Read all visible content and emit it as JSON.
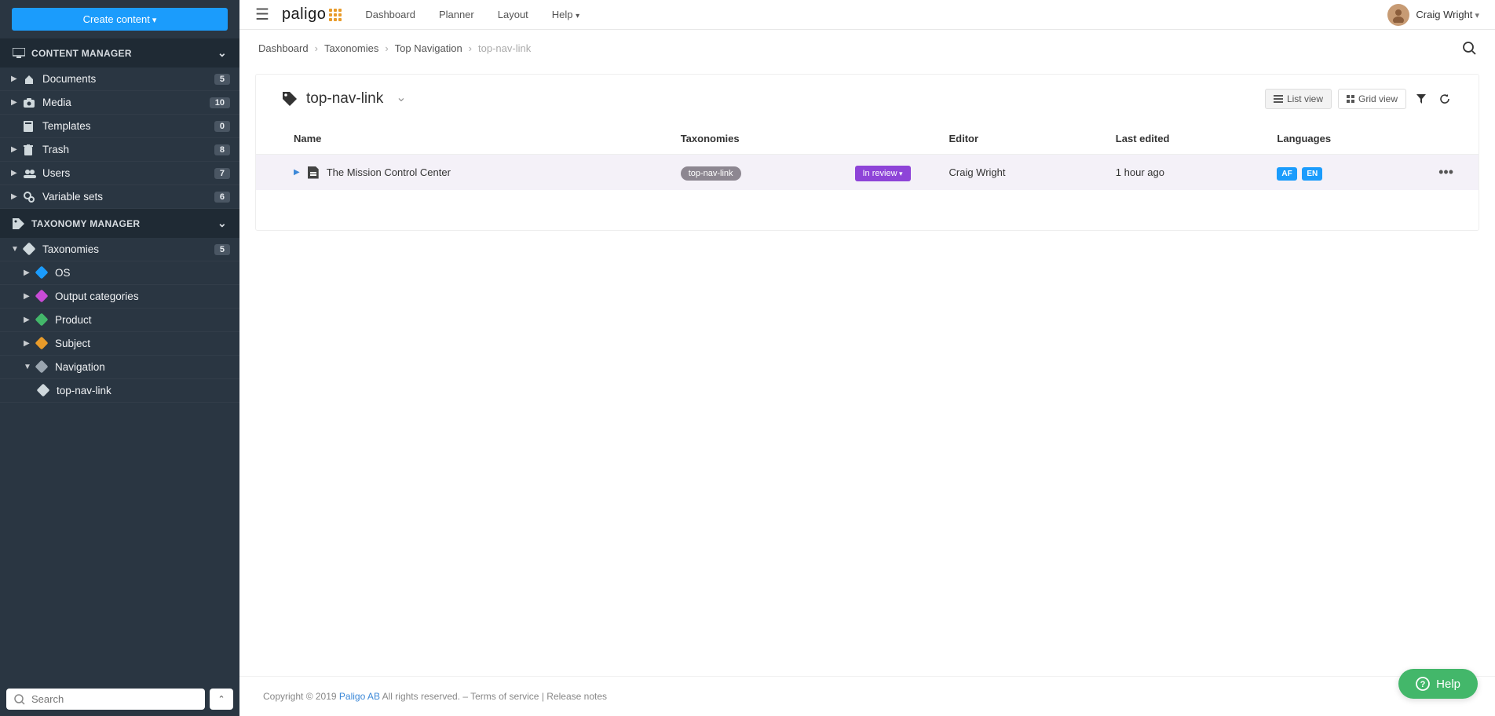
{
  "sidebar": {
    "create_label": "Create content",
    "section_content": "CONTENT MANAGER",
    "section_taxonomy": "TAXONOMY MANAGER",
    "items": [
      {
        "label": "Documents",
        "count": "5"
      },
      {
        "label": "Media",
        "count": "10"
      },
      {
        "label": "Templates",
        "count": "0"
      },
      {
        "label": "Trash",
        "count": "8"
      },
      {
        "label": "Users",
        "count": "7"
      },
      {
        "label": "Variable sets",
        "count": "6"
      }
    ],
    "tax_root": {
      "label": "Taxonomies",
      "count": "5"
    },
    "tax_children": [
      {
        "label": "OS",
        "color": "#1b9cfc"
      },
      {
        "label": "Output categories",
        "color": "#c84bd6"
      },
      {
        "label": "Product",
        "color": "#43b76a"
      },
      {
        "label": "Subject",
        "color": "#e89b2a"
      },
      {
        "label": "Navigation",
        "color": "#9aa5af"
      }
    ],
    "tax_leaf": "top-nav-link",
    "search_placeholder": "Search"
  },
  "topnav": {
    "items": [
      "Dashboard",
      "Planner",
      "Layout",
      "Help"
    ],
    "user": "Craig Wright"
  },
  "breadcrumb": [
    "Dashboard",
    "Taxonomies",
    "Top Navigation",
    "top-nav-link"
  ],
  "page": {
    "title": "top-nav-link",
    "list_view": "List view",
    "grid_view": "Grid view"
  },
  "table": {
    "headers": [
      "Name",
      "Taxonomies",
      "Editor",
      "Last edited",
      "Languages"
    ],
    "row": {
      "name": "The Mission Control Center",
      "tax": "top-nav-link",
      "status": "In review",
      "editor": "Craig Wright",
      "last": "1 hour ago",
      "langs": [
        "AF",
        "EN"
      ]
    }
  },
  "footer": {
    "prefix": "Copyright © 2019 ",
    "link": "Paligo AB",
    "mid": " All rights reserved. – ",
    "tos": "Terms of service",
    "sep": " | ",
    "rel": "Release notes"
  },
  "help_label": "Help"
}
